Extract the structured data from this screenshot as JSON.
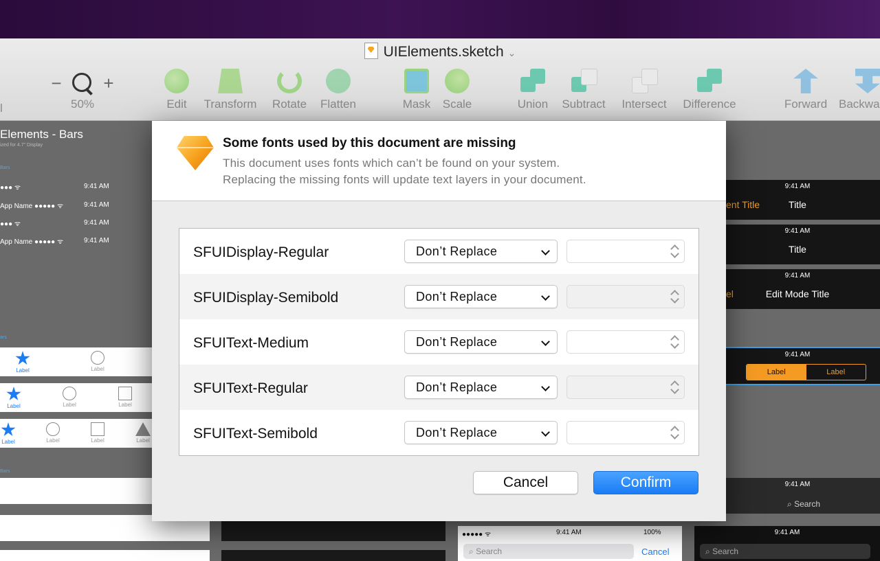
{
  "window": {
    "title": "UIElements.sketch"
  },
  "toolbar": {
    "zoom_minus": "−",
    "zoom_plus": "+",
    "zoom_level": "50%",
    "left_partial": "l",
    "tools": [
      {
        "label": "Edit",
        "icon": "edit-icon"
      },
      {
        "label": "Transform",
        "icon": "transform-icon"
      },
      {
        "label": "Rotate",
        "icon": "rotate-icon"
      },
      {
        "label": "Flatten",
        "icon": "flatten-icon"
      },
      {
        "label": "Mask",
        "icon": "mask-icon"
      },
      {
        "label": "Scale",
        "icon": "scale-icon"
      },
      {
        "label": "Union",
        "icon": "union-icon"
      },
      {
        "label": "Subtract",
        "icon": "subtract-icon"
      },
      {
        "label": "Intersect",
        "icon": "intersect-icon"
      },
      {
        "label": "Difference",
        "icon": "difference-icon"
      },
      {
        "label": "Forward",
        "icon": "forward-icon"
      },
      {
        "label": "Backwa",
        "icon": "backward-icon"
      }
    ]
  },
  "canvas": {
    "artboard_title": "Elements - Bars",
    "artboard_sub": "ized for 4.7\" Display",
    "section_bars": "Bars",
    "section_tab": "ars",
    "section_tab2": "Bars",
    "status_rows": [
      {
        "left": "●●● ᯤ",
        "time": "9:41 AM"
      },
      {
        "left": "App Name ●●●●● ᯤ",
        "time": "9:41 AM"
      },
      {
        "left": "●●● ᯤ",
        "time": "9:41 AM"
      },
      {
        "left": "App Name ●●●●● ᯤ",
        "time": "9:41 AM"
      }
    ],
    "tab_label": "Label",
    "dark_bars": [
      {
        "time": "9:41 AM",
        "title": "Title",
        "left": "ent Title"
      },
      {
        "time": "9:41 AM",
        "title": "Title",
        "left": ""
      },
      {
        "time": "9:41 AM",
        "title": "Edit Mode Title",
        "left": "el"
      },
      {
        "time": "9:41 AM",
        "title": "",
        "left": ""
      },
      {
        "time": "9:41 AM",
        "title": "",
        "left": ""
      },
      {
        "time": "9:41 AM",
        "title": "",
        "left": ""
      }
    ],
    "segment": [
      "Label",
      "Label"
    ],
    "search_dark": "Search",
    "search_light_status": {
      "carrier": "●●●●● ᯤ",
      "time": "9:41 AM",
      "battery": "100%"
    },
    "search_placeholder": "Search",
    "search_cancel": "Cancel",
    "accent_blue": "#1c7cf4",
    "accent_orange": "#f59a23"
  },
  "dialog": {
    "title": "Some fonts used by this document are missing",
    "line1": "This document uses fonts which can’t be found on your system.",
    "line2": "Replacing the missing fonts will update text layers in your document.",
    "fonts": [
      {
        "name": "SFUIDisplay-Regular",
        "replacement": "Don’t Replace"
      },
      {
        "name": "SFUIDisplay-Semibold",
        "replacement": "Don’t Replace"
      },
      {
        "name": "SFUIText-Medium",
        "replacement": "Don’t Replace"
      },
      {
        "name": "SFUIText-Regular",
        "replacement": "Don’t Replace"
      },
      {
        "name": "SFUIText-Semibold",
        "replacement": "Don’t Replace"
      }
    ],
    "cancel_label": "Cancel",
    "confirm_label": "Confirm"
  }
}
